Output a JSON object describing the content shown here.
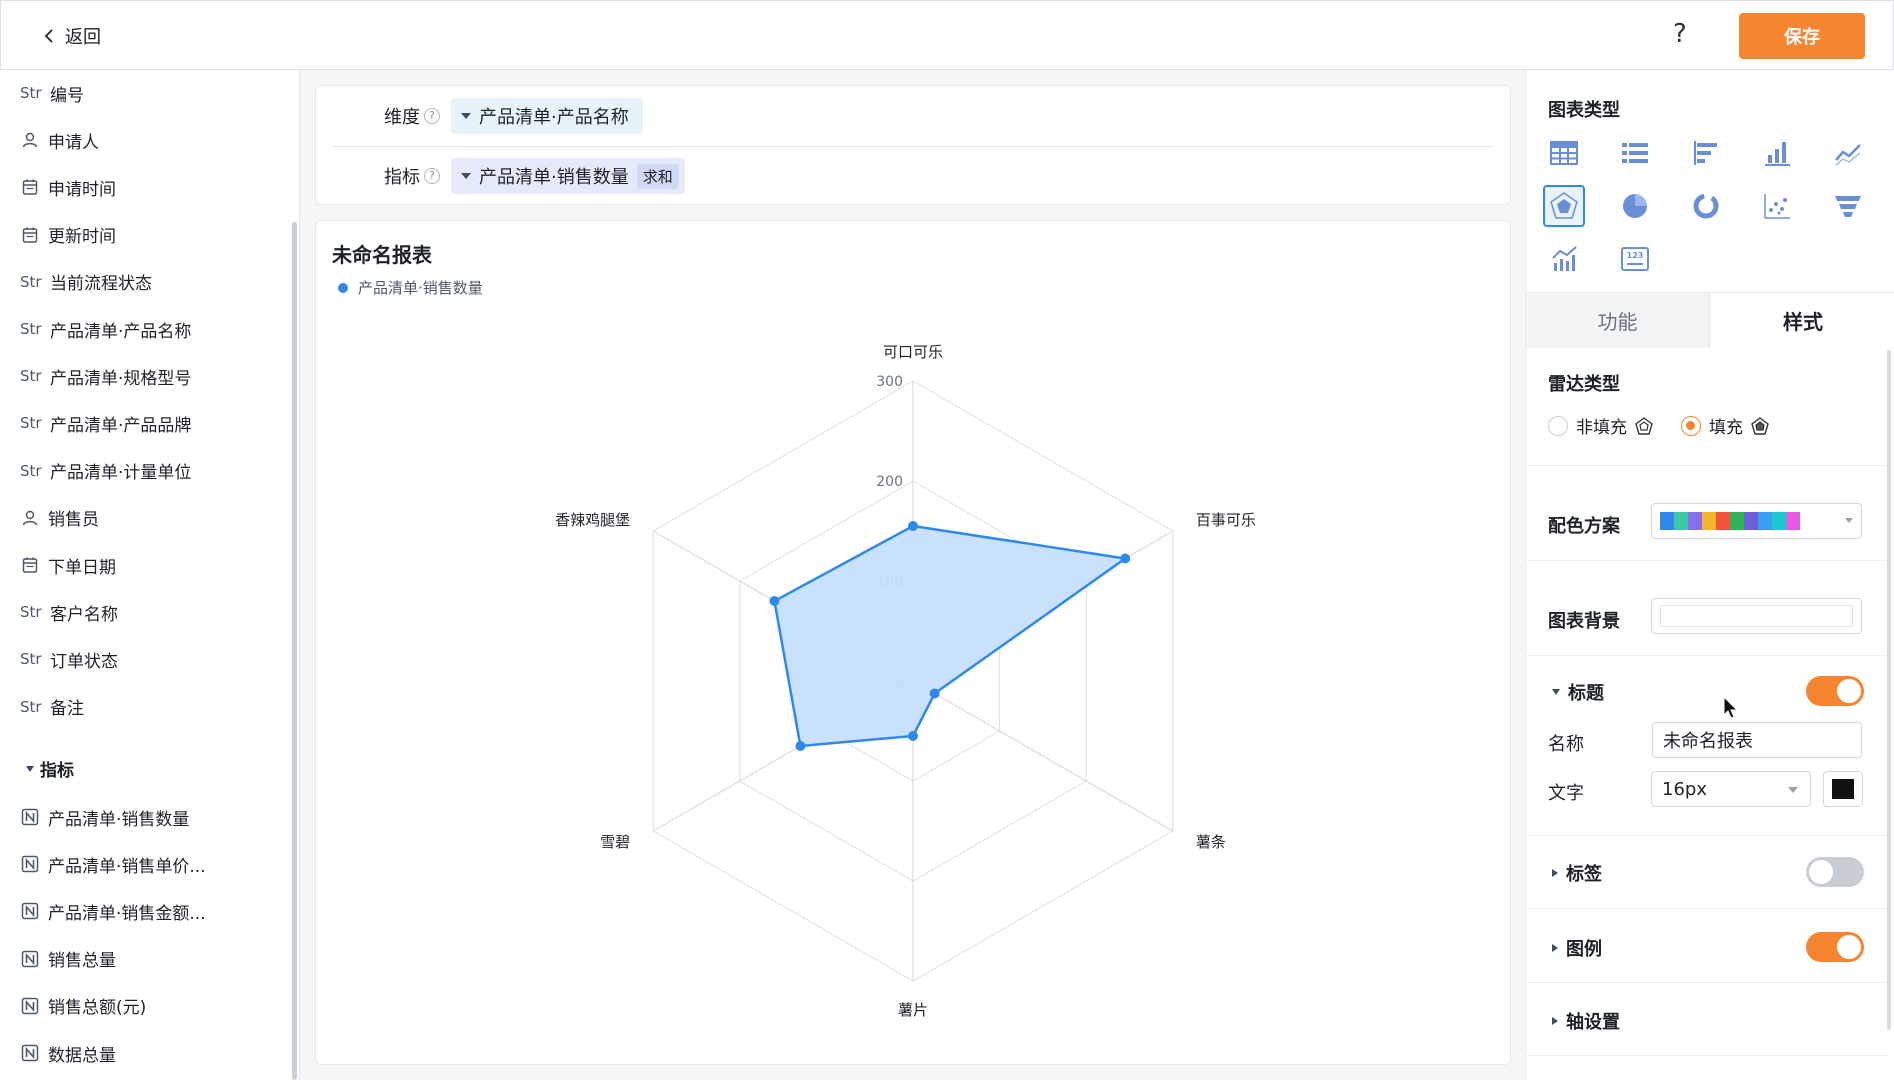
{
  "header": {
    "back_label": "返回",
    "help_label": "?",
    "save_label": "保存"
  },
  "sidebar": {
    "fields": [
      {
        "type": "Str",
        "icon": null,
        "label": "编号"
      },
      {
        "type": "",
        "icon": "user-icon",
        "label": "申请人"
      },
      {
        "type": "",
        "icon": "calendar-icon",
        "label": "申请时间"
      },
      {
        "type": "",
        "icon": "calendar-icon",
        "label": "更新时间"
      },
      {
        "type": "Str",
        "icon": null,
        "label": "当前流程状态"
      },
      {
        "type": "Str",
        "icon": null,
        "label": "产品清单·产品名称"
      },
      {
        "type": "Str",
        "icon": null,
        "label": "产品清单·规格型号"
      },
      {
        "type": "Str",
        "icon": null,
        "label": "产品清单·产品品牌"
      },
      {
        "type": "Str",
        "icon": null,
        "label": "产品清单·计量单位"
      },
      {
        "type": "",
        "icon": "user-icon",
        "label": "销售员"
      },
      {
        "type": "",
        "icon": "calendar-icon",
        "label": "下单日期"
      },
      {
        "type": "Str",
        "icon": null,
        "label": "客户名称"
      },
      {
        "type": "Str",
        "icon": null,
        "label": "订单状态"
      },
      {
        "type": "Str",
        "icon": null,
        "label": "备注"
      }
    ],
    "metric_group_label": "指标",
    "metrics": [
      {
        "icon": "number-field-icon",
        "label": "产品清单·销售数量"
      },
      {
        "icon": "number-field-icon",
        "label": "产品清单·销售单价..."
      },
      {
        "icon": "number-field-icon",
        "label": "产品清单·销售金额..."
      },
      {
        "icon": "number-field-icon",
        "label": "销售总量"
      },
      {
        "icon": "number-field-icon",
        "label": "销售总额(元)"
      },
      {
        "icon": "number-field-icon",
        "label": "数据总量"
      }
    ]
  },
  "config": {
    "dimension_label": "维度",
    "dimension_value": "产品清单·产品名称",
    "metric_label": "指标",
    "metric_value": "产品清单·销售数量",
    "metric_agg": "求和"
  },
  "chart_data": {
    "type": "radar",
    "title": "未命名报表",
    "categories": [
      "可口可乐",
      "百事可乐",
      "薯条",
      "薯片",
      "雪碧",
      "香辣鸡腿堡"
    ],
    "series": [
      {
        "name": "产品清单·销售数量",
        "values": [
          155,
          245,
          25,
          55,
          130,
          160
        ]
      }
    ],
    "rlim": [
      0,
      300
    ],
    "ticks": [
      0,
      100,
      200,
      300
    ],
    "fill": true,
    "color": "#2f89e8",
    "fill_color": "#c6dffa",
    "legend": "top-left"
  },
  "panel": {
    "chart_type_title": "图表类型",
    "chart_types": [
      "table-icon",
      "list-icon",
      "horizontal-bar-icon",
      "bar-chart-icon",
      "line-chart-icon",
      "radar-chart-icon",
      "pie-chart-icon",
      "donut-chart-icon",
      "scatter-chart-icon",
      "funnel-chart-icon",
      "combo-chart-icon",
      "number-card-icon"
    ],
    "selected_chart_type": "radar-chart-icon",
    "tab_function": "功能",
    "tab_style": "样式",
    "radar_type_title": "雷达类型",
    "radar_option_unfilled": "非填充",
    "radar_option_filled": "填充",
    "radar_selected": "filled",
    "palette_label": "配色方案",
    "palette": [
      "#2f89e8",
      "#3bc9a8",
      "#8a6de9",
      "#f5b731",
      "#f0553d",
      "#33b45a",
      "#6f5fd6",
      "#3a9ef5",
      "#1cc7d0",
      "#e25ce8"
    ],
    "background_label": "图表背景",
    "title_section": {
      "label": "标题",
      "expanded": true,
      "enabled": true
    },
    "name_label": "名称",
    "name_value": "未命名报表",
    "text_label": "文字",
    "font_size_value": "16px",
    "text_color": "#111111",
    "label_section": {
      "label": "标签",
      "enabled": false
    },
    "legend_section": {
      "label": "图例",
      "enabled": true
    },
    "axis_section": {
      "label": "轴设置"
    }
  }
}
